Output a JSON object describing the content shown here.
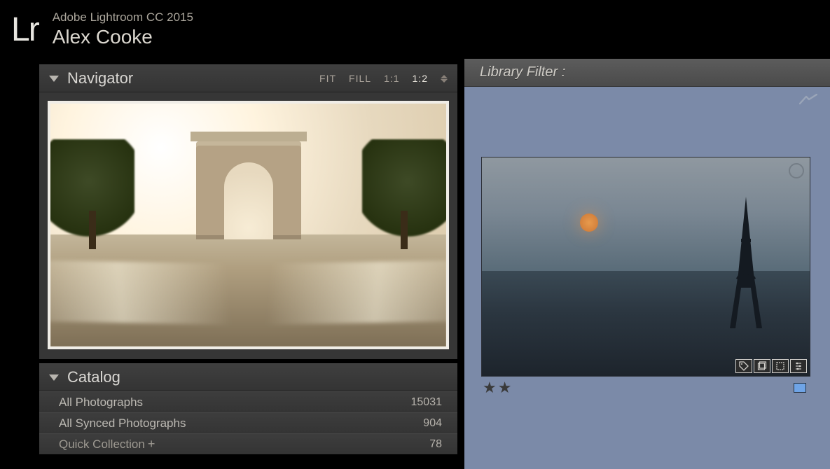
{
  "app": {
    "logo_text": "Lr",
    "title": "Adobe Lightroom CC 2015",
    "user": "Alex Cooke"
  },
  "navigator": {
    "title": "Navigator",
    "zoom": {
      "fit": "FIT",
      "fill": "FILL",
      "one_one": "1:1",
      "one_two": "1:2"
    }
  },
  "catalog": {
    "title": "Catalog",
    "rows": [
      {
        "label": "All Photographs",
        "count": "15031"
      },
      {
        "label": "All Synced Photographs",
        "count": "904"
      },
      {
        "label": "Quick Collection",
        "count": "78",
        "plus": "+"
      }
    ]
  },
  "library_filter": {
    "title": "Library Filter :"
  },
  "grid": {
    "rating_stars": "★★",
    "badge_icons": {
      "tag": "tag-icon",
      "collection": "collection-icon",
      "crop": "crop-icon",
      "develop": "develop-icon"
    }
  }
}
